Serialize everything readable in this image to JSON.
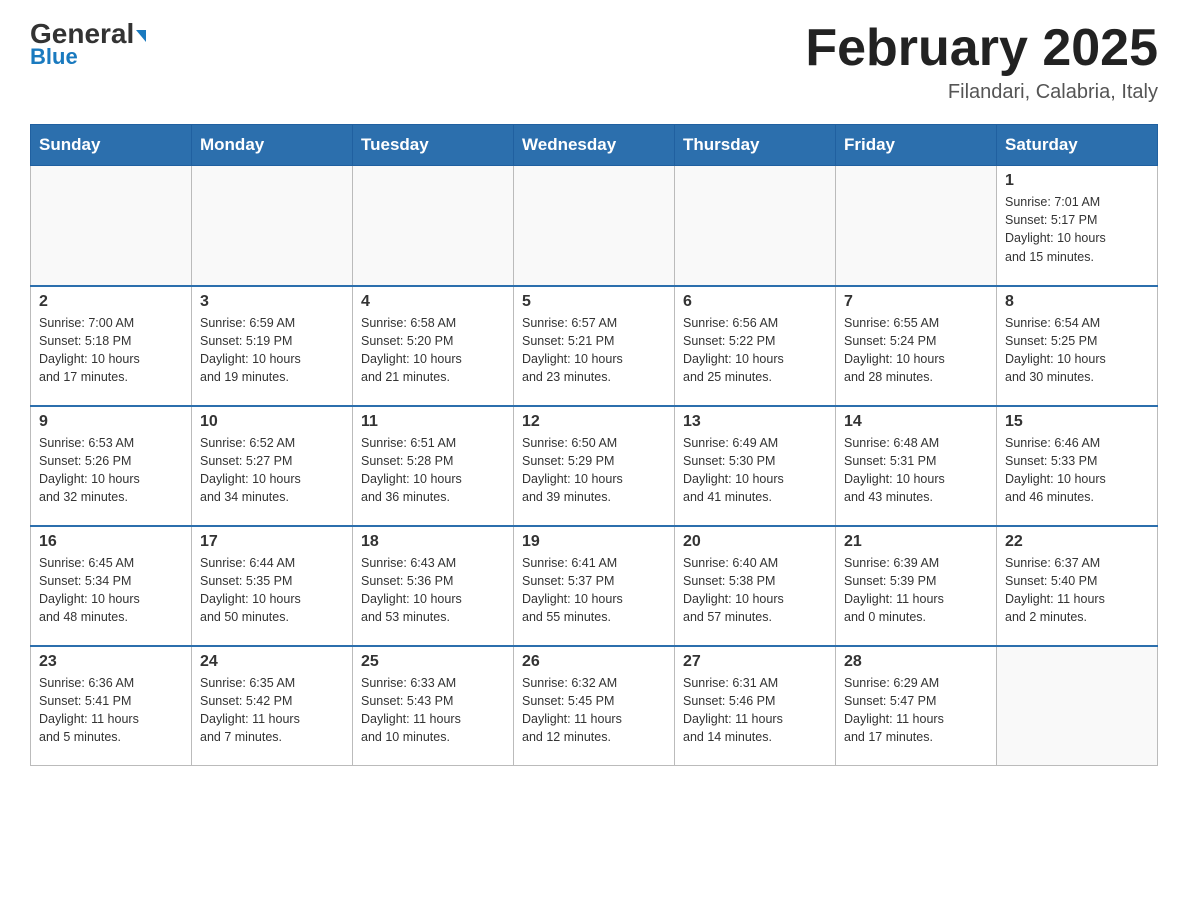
{
  "header": {
    "logo_top": "General",
    "logo_bottom": "Blue",
    "month_title": "February 2025",
    "location": "Filandari, Calabria, Italy"
  },
  "days_of_week": [
    "Sunday",
    "Monday",
    "Tuesday",
    "Wednesday",
    "Thursday",
    "Friday",
    "Saturday"
  ],
  "weeks": [
    [
      {
        "day": "",
        "info": ""
      },
      {
        "day": "",
        "info": ""
      },
      {
        "day": "",
        "info": ""
      },
      {
        "day": "",
        "info": ""
      },
      {
        "day": "",
        "info": ""
      },
      {
        "day": "",
        "info": ""
      },
      {
        "day": "1",
        "info": "Sunrise: 7:01 AM\nSunset: 5:17 PM\nDaylight: 10 hours\nand 15 minutes."
      }
    ],
    [
      {
        "day": "2",
        "info": "Sunrise: 7:00 AM\nSunset: 5:18 PM\nDaylight: 10 hours\nand 17 minutes."
      },
      {
        "day": "3",
        "info": "Sunrise: 6:59 AM\nSunset: 5:19 PM\nDaylight: 10 hours\nand 19 minutes."
      },
      {
        "day": "4",
        "info": "Sunrise: 6:58 AM\nSunset: 5:20 PM\nDaylight: 10 hours\nand 21 minutes."
      },
      {
        "day": "5",
        "info": "Sunrise: 6:57 AM\nSunset: 5:21 PM\nDaylight: 10 hours\nand 23 minutes."
      },
      {
        "day": "6",
        "info": "Sunrise: 6:56 AM\nSunset: 5:22 PM\nDaylight: 10 hours\nand 25 minutes."
      },
      {
        "day": "7",
        "info": "Sunrise: 6:55 AM\nSunset: 5:24 PM\nDaylight: 10 hours\nand 28 minutes."
      },
      {
        "day": "8",
        "info": "Sunrise: 6:54 AM\nSunset: 5:25 PM\nDaylight: 10 hours\nand 30 minutes."
      }
    ],
    [
      {
        "day": "9",
        "info": "Sunrise: 6:53 AM\nSunset: 5:26 PM\nDaylight: 10 hours\nand 32 minutes."
      },
      {
        "day": "10",
        "info": "Sunrise: 6:52 AM\nSunset: 5:27 PM\nDaylight: 10 hours\nand 34 minutes."
      },
      {
        "day": "11",
        "info": "Sunrise: 6:51 AM\nSunset: 5:28 PM\nDaylight: 10 hours\nand 36 minutes."
      },
      {
        "day": "12",
        "info": "Sunrise: 6:50 AM\nSunset: 5:29 PM\nDaylight: 10 hours\nand 39 minutes."
      },
      {
        "day": "13",
        "info": "Sunrise: 6:49 AM\nSunset: 5:30 PM\nDaylight: 10 hours\nand 41 minutes."
      },
      {
        "day": "14",
        "info": "Sunrise: 6:48 AM\nSunset: 5:31 PM\nDaylight: 10 hours\nand 43 minutes."
      },
      {
        "day": "15",
        "info": "Sunrise: 6:46 AM\nSunset: 5:33 PM\nDaylight: 10 hours\nand 46 minutes."
      }
    ],
    [
      {
        "day": "16",
        "info": "Sunrise: 6:45 AM\nSunset: 5:34 PM\nDaylight: 10 hours\nand 48 minutes."
      },
      {
        "day": "17",
        "info": "Sunrise: 6:44 AM\nSunset: 5:35 PM\nDaylight: 10 hours\nand 50 minutes."
      },
      {
        "day": "18",
        "info": "Sunrise: 6:43 AM\nSunset: 5:36 PM\nDaylight: 10 hours\nand 53 minutes."
      },
      {
        "day": "19",
        "info": "Sunrise: 6:41 AM\nSunset: 5:37 PM\nDaylight: 10 hours\nand 55 minutes."
      },
      {
        "day": "20",
        "info": "Sunrise: 6:40 AM\nSunset: 5:38 PM\nDaylight: 10 hours\nand 57 minutes."
      },
      {
        "day": "21",
        "info": "Sunrise: 6:39 AM\nSunset: 5:39 PM\nDaylight: 11 hours\nand 0 minutes."
      },
      {
        "day": "22",
        "info": "Sunrise: 6:37 AM\nSunset: 5:40 PM\nDaylight: 11 hours\nand 2 minutes."
      }
    ],
    [
      {
        "day": "23",
        "info": "Sunrise: 6:36 AM\nSunset: 5:41 PM\nDaylight: 11 hours\nand 5 minutes."
      },
      {
        "day": "24",
        "info": "Sunrise: 6:35 AM\nSunset: 5:42 PM\nDaylight: 11 hours\nand 7 minutes."
      },
      {
        "day": "25",
        "info": "Sunrise: 6:33 AM\nSunset: 5:43 PM\nDaylight: 11 hours\nand 10 minutes."
      },
      {
        "day": "26",
        "info": "Sunrise: 6:32 AM\nSunset: 5:45 PM\nDaylight: 11 hours\nand 12 minutes."
      },
      {
        "day": "27",
        "info": "Sunrise: 6:31 AM\nSunset: 5:46 PM\nDaylight: 11 hours\nand 14 minutes."
      },
      {
        "day": "28",
        "info": "Sunrise: 6:29 AM\nSunset: 5:47 PM\nDaylight: 11 hours\nand 17 minutes."
      },
      {
        "day": "",
        "info": ""
      }
    ]
  ]
}
